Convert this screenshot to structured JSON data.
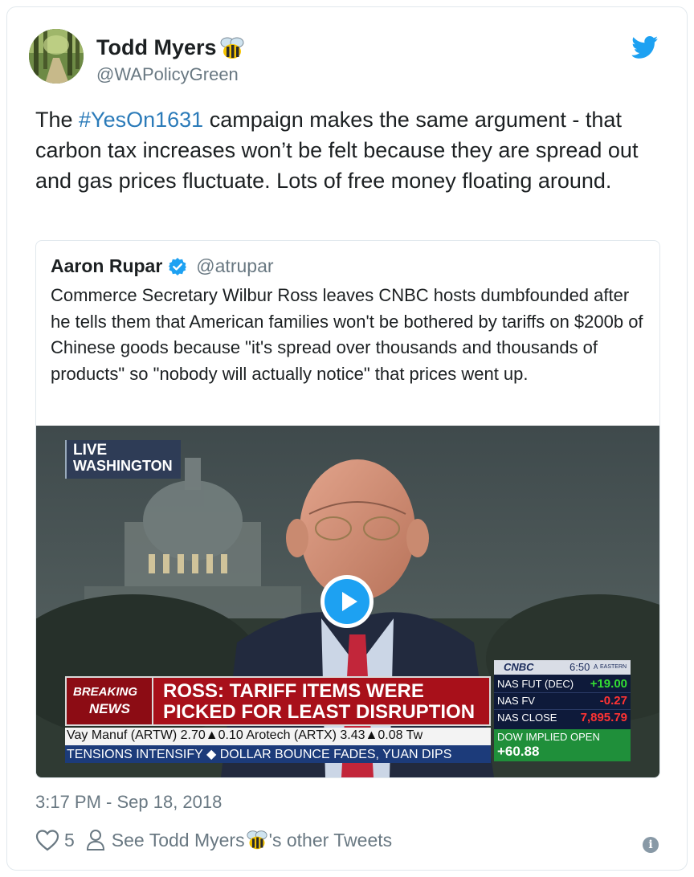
{
  "author": {
    "name": "Todd Myers",
    "handle": "@WAPolicyGreen"
  },
  "tweet": {
    "text_before": "The ",
    "hashtag": "#YesOn1631",
    "text_after": " campaign makes the same argument - that carbon tax increases won’t be felt because they are spread out and gas prices fluctuate. Lots of free money floating around."
  },
  "quoted": {
    "name": "Aaron Rupar",
    "handle": "@atrupar",
    "text": "Commerce Secretary Wilbur Ross leaves CNBC hosts dumbfounded after he tells them that American families won't be bothered by tariffs on $200b of Chinese goods because \"it's spread over thousands and thousands of products\" so \"nobody will actually notice\" that prices went up."
  },
  "video": {
    "live_label": "LIVE",
    "location": "WASHINGTON",
    "breaking_1": "BREAKING",
    "breaking_2": "NEWS",
    "headline_1": "ROSS: TARIFF ITEMS WERE",
    "headline_2": "PICKED FOR LEAST DISRUPTION",
    "ticker_1": "Vay Manuf (ARTW) 2.70▲0.10   Arotech (ARTX) 3.43▲0.08   Tw",
    "ticker_2": "TENSIONS INTENSIFY  ◆ DOLLAR BOUNCE FADES, YUAN DIPS",
    "network": "CNBC",
    "time": "6:50",
    "time_suffix": "A",
    "time_zone": "EASTERN",
    "market": [
      {
        "label": "NAS FUT (DEC)",
        "value": "+19.00",
        "color": "#33dd33"
      },
      {
        "label": "NAS FV",
        "value": "-0.27",
        "color": "#ff3333"
      },
      {
        "label": "NAS CLOSE",
        "value": "7,895.79",
        "color": "#ff3333"
      }
    ],
    "dow_label": "DOW IMPLIED OPEN",
    "dow_value": "+60.88"
  },
  "timestamp": "3:17 PM - Sep 18, 2018",
  "likes": "5",
  "see_other_prefix": "See Todd Myers",
  "see_other_suffix": "'s other Tweets",
  "colors": {
    "link": "#2b7bb9",
    "twitter_blue": "#1da1f2",
    "like_heart": "#697882",
    "breaking_red": "#b0121b",
    "dow_green": "#1f8f3a"
  }
}
